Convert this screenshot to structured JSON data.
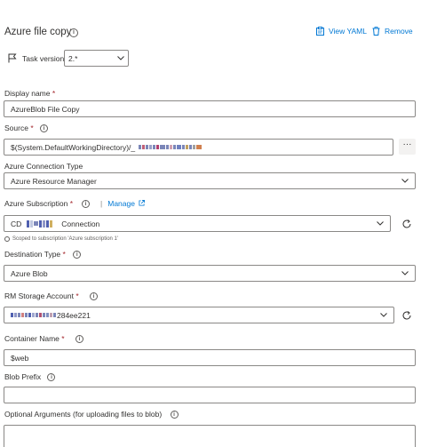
{
  "header": {
    "title": "Azure file copy",
    "view_yaml": "View YAML",
    "remove": "Remove"
  },
  "task_version": {
    "label": "Task version",
    "value": "2.*"
  },
  "fields": {
    "display_name": {
      "label": "Display name",
      "value": "AzureBlob File Copy"
    },
    "source": {
      "label": "Source",
      "value": "$(System.DefaultWorkingDirectory)/_",
      "more": "···"
    },
    "connection_type": {
      "label": "Azure Connection Type",
      "value": "Azure Resource Manager"
    },
    "subscription": {
      "label": "Azure Subscription",
      "manage": "Manage",
      "value_prefix": "CD",
      "value_suffix": "Connection",
      "note": "Scoped to subscription 'Azure subscription 1'"
    },
    "destination_type": {
      "label": "Destination Type",
      "value": "Azure Blob"
    },
    "storage_account": {
      "label": "RM Storage Account",
      "value_suffix": "284ee221"
    },
    "container_name": {
      "label": "Container Name",
      "value": "$web"
    },
    "blob_prefix": {
      "label": "Blob Prefix",
      "value": ""
    },
    "optional_args": {
      "label": "Optional Arguments (for uploading files to blob)",
      "value": ""
    }
  },
  "required_mark": "*",
  "info_glyph": "i",
  "manage_separator": "|",
  "colors": {
    "link": "#0078d4",
    "border": "#8a8886",
    "required": "#a4262c",
    "text": "#323130"
  }
}
